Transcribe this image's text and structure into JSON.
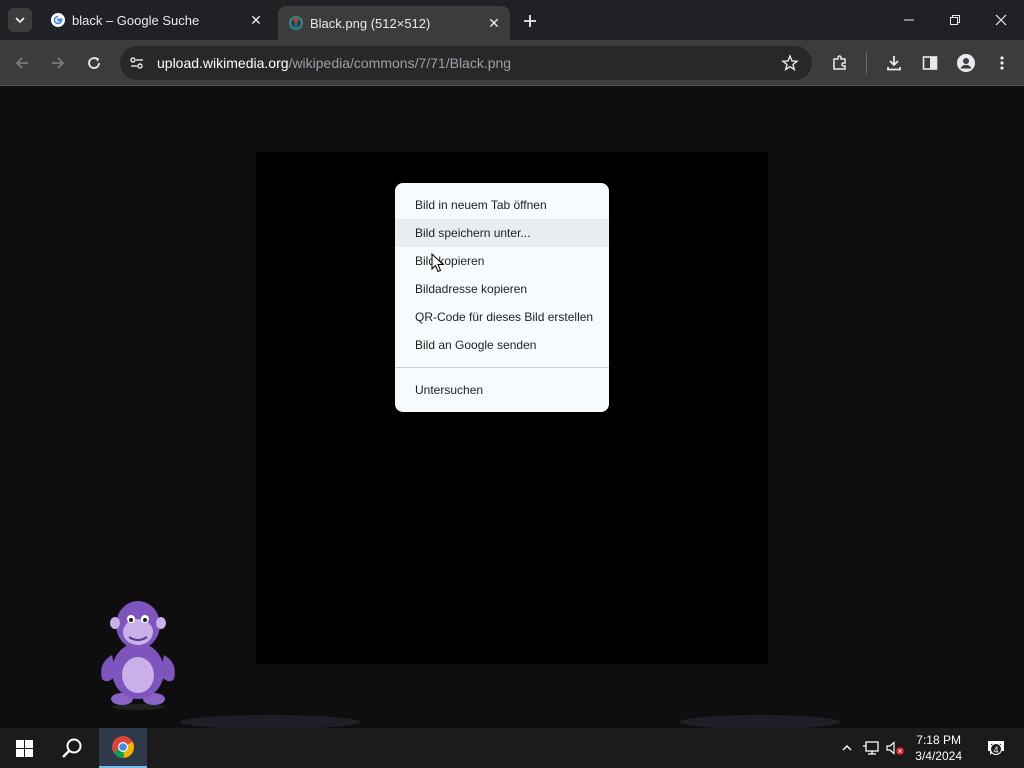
{
  "tabs": [
    {
      "title": "black – Google Suche",
      "icon": "google-g-icon"
    },
    {
      "title": "Black.png (512×512)",
      "icon": "wikimedia-icon",
      "active": true
    }
  ],
  "address": {
    "host": "upload.wikimedia.org",
    "path": "/wikipedia/commons/7/71/Black.png"
  },
  "context_menu": {
    "items": [
      {
        "label": "Bild in neuem Tab öffnen"
      },
      {
        "label": "Bild speichern unter...",
        "hovered": true
      },
      {
        "label": "Bild kopieren"
      },
      {
        "label": "Bildadresse kopieren"
      },
      {
        "label": "QR-Code für dieses Bild erstellen"
      },
      {
        "label": "Bild an Google senden"
      }
    ],
    "inspect_label": "Untersuchen"
  },
  "taskbar": {
    "time": "7:18 PM",
    "date": "3/4/2024",
    "notification_count": "4"
  },
  "colors": {
    "tabstrip": "#202124",
    "toolbar": "#3c3c3c",
    "page_bg": "#0e0e0e",
    "menu_bg": "#f7fbfd",
    "taskbar": "#1b1b1b"
  }
}
